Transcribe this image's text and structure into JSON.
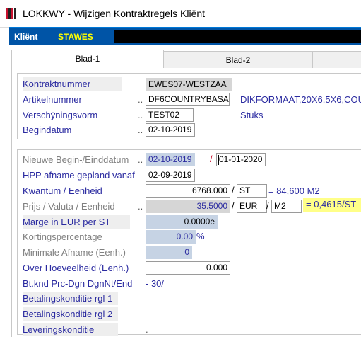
{
  "window": {
    "title": "LOKKWY - Wijzigen Kontraktregels Kliënt"
  },
  "client": {
    "label": "Kliënt",
    "value": "STAWES"
  },
  "tabs": [
    {
      "label": "Blad-1"
    },
    {
      "label": "Blad-2"
    },
    {
      "label": ""
    }
  ],
  "header_section": {
    "kontraktnummer": {
      "label": "Kontraktnummer",
      "value": "EWES07-WESTZAA"
    },
    "artikelnummer": {
      "label": "Artikelnummer",
      "dots": "..",
      "value": "DF6COUNTRYBASA",
      "description": "DIKFORMAAT,20X6.5X6,COU"
    },
    "verschijningsvorm": {
      "label": "Verschÿningsvorm",
      "dots": "..",
      "value": "TEST02",
      "description": "Stuks"
    },
    "begindatum": {
      "label": "Begindatum",
      "dots": "..",
      "value": "02-10-2019"
    }
  },
  "detail_section": {
    "nieuwe_datum": {
      "label": "Nieuwe Begin-/Einddatum",
      "dots": "..",
      "begin": "02-10-2019",
      "sep": "/",
      "eind": "01-01-2020"
    },
    "hpp_afname": {
      "label": "HPP afname gepland vanaf",
      "value": "02-09-2019"
    },
    "kwantum": {
      "label": "Kwantum / Eenheid",
      "value": "6768.000",
      "sep": "/",
      "unit": "ST",
      "result": "= 84,600 M2"
    },
    "prijs": {
      "label": "Prijs / Valuta / Eenheid",
      "dots": "..",
      "value": "35.5000",
      "sep1": "/",
      "valuta": "EUR",
      "sep2": "/",
      "unit": "M2",
      "result": "= 0,4615/ST"
    },
    "marge": {
      "label": "Marge in EUR per ST",
      "value": "0.0000e"
    },
    "korting": {
      "label": "Kortingspercentage",
      "value": "0.00",
      "unit": "%"
    },
    "minimale_afname": {
      "label": "Minimale Afname (Eenh.)",
      "value": "0"
    },
    "over_hoeveelheid": {
      "label": "Over Hoeveelheid (Eenh.)",
      "value": "0.000"
    },
    "bt_knd": {
      "label": "Bt.knd Prc-Dgn DgnNt/End",
      "value": "- 30/"
    },
    "betalingskonditie1": {
      "label": "Betalingskonditie rgl 1"
    },
    "betalingskonditie2": {
      "label": "Betalingskonditie rgl 2"
    },
    "leveringskonditie": {
      "label": "Leveringskonditie",
      "value": "."
    }
  }
}
